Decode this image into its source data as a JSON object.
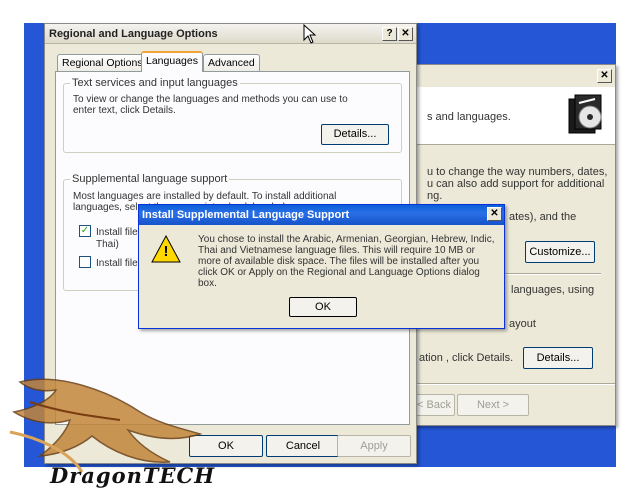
{
  "regional_window": {
    "title": "Regional and Language Options",
    "help_btn": "?",
    "close_btn": "✕",
    "tabs": [
      {
        "label": "Regional Options"
      },
      {
        "label": "Languages"
      },
      {
        "label": "Advanced"
      }
    ],
    "text_services": {
      "legend": "Text services and input languages",
      "description": "To view or change the languages and methods you can use to enter text, click Details.",
      "details_label": "Details..."
    },
    "supplemental": {
      "legend": "Supplemental language support",
      "description": "Most languages are installed by default. To install additional languages, select the appropriate check box below.",
      "install_complex": "Install files",
      "install_complex_cont": "Thai)",
      "install_east_asian": "Install files"
    },
    "ok_label": "OK",
    "cancel_label": "Cancel",
    "apply_label": "Apply"
  },
  "back_window": {
    "close_btn": "✕",
    "text1": "s and languages.",
    "text2a": "u to change the way numbers, dates,",
    "text2b": "u can also add support for additional",
    "text2c": "ng.",
    "text3a": "ates), and the",
    "customize_label": "Customize...",
    "text4a": "languages, using",
    "text5": "ayout",
    "text6": "ation , click Details.",
    "details_label": "Details...",
    "back_label": "< Back",
    "next_label": "Next >"
  },
  "message_box": {
    "title": "Install Supplemental Language Support",
    "close_btn": "✕",
    "message": "You chose to install the Arabic, Armenian, Georgian, Hebrew, Indic, Thai and Vietnamese language files. This will require 10 MB or more of available disk space. The files will be installed after you click OK or Apply on the Regional and Language Options dialog box.",
    "ok_label": "OK",
    "warning_glyph": "!"
  },
  "watermark": {
    "text": "DragonTECH"
  }
}
